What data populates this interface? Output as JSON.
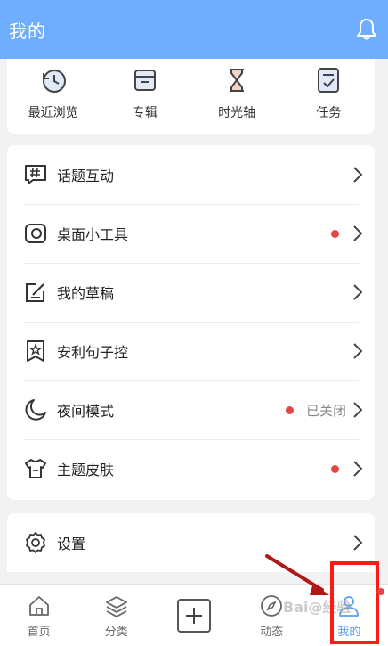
{
  "header": {
    "title": "我的",
    "bell_icon": "bell-icon"
  },
  "quick_actions": [
    {
      "label": "最近浏览",
      "icon": "history-clock-icon"
    },
    {
      "label": "专辑",
      "icon": "album-box-icon"
    },
    {
      "label": "时光轴",
      "icon": "hourglass-icon"
    },
    {
      "label": "任务",
      "icon": "task-checklist-icon"
    }
  ],
  "menu": [
    {
      "label": "话题互动",
      "icon": "hashtag-chat-icon",
      "dot": false,
      "status": ""
    },
    {
      "label": "桌面小工具",
      "icon": "widget-icon",
      "dot": true,
      "status": ""
    },
    {
      "label": "我的草稿",
      "icon": "draft-edit-icon",
      "dot": false,
      "status": ""
    },
    {
      "label": "安利句子控",
      "icon": "bookmark-star-icon",
      "dot": false,
      "status": ""
    },
    {
      "label": "夜间模式",
      "icon": "moon-icon",
      "dot": true,
      "status": "已关闭"
    },
    {
      "label": "主题皮肤",
      "icon": "tshirt-icon",
      "dot": true,
      "status": ""
    }
  ],
  "settings": {
    "label": "设置",
    "icon": "gear-icon"
  },
  "tabbar": [
    {
      "label": "首页",
      "icon": "home-icon",
      "active": false
    },
    {
      "label": "分类",
      "icon": "layers-icon",
      "active": false
    },
    {
      "label": "",
      "icon": "add-icon",
      "active": false
    },
    {
      "label": "动态",
      "icon": "compass-icon",
      "active": false
    },
    {
      "label": "我的",
      "icon": "user-icon",
      "active": true
    }
  ],
  "watermark": "Bai@经验",
  "colors": {
    "header": "#6faeff",
    "accent": "#5a9ef5",
    "dot": "#e64545",
    "highlight": "#ff1a1a"
  }
}
